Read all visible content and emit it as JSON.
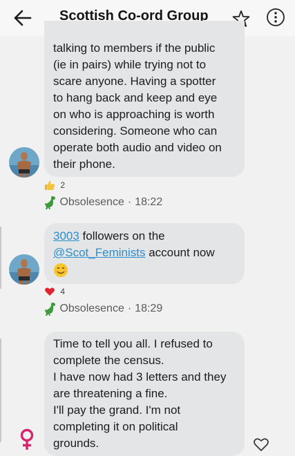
{
  "header": {
    "title": "Scottish Co-ord Group",
    "back_icon": "back-arrow-icon",
    "star_icon": "star-outline-icon",
    "more_icon": "more-vertical-icon"
  },
  "messages": [
    {
      "lines": [
        "talking to members if the public",
        "(ie in pairs) while trying not to",
        "scare anyone. Having a spotter",
        "to hang back and keep and eye",
        "on who is approaching is worth",
        "considering. Someone who can",
        "operate both audio and video on",
        "their phone."
      ],
      "reaction": {
        "icon": "thumbs-up-icon",
        "count": "2"
      },
      "sender": "Obsolesence",
      "separator": "·",
      "time": "18:22"
    },
    {
      "line1_link": "3003",
      "line1_text": " followers on the",
      "line2_link": "@Scot_Feminists",
      "line2_text": "  account now",
      "emoji": "smiling-face-icon",
      "reaction": {
        "icon": "heart-icon",
        "count": "4"
      },
      "sender": "Obsolesence",
      "separator": "·",
      "time": "18:29"
    },
    {
      "lines": [
        "Time to tell you all.  I refused to",
        "complete the census.",
        "I have now had 3 letters and they",
        "are threatening a fine.",
        "I'll pay the grand.  I'm not",
        "completing it on political",
        "grounds."
      ]
    }
  ],
  "colors": {
    "background": "#f1f1f1",
    "bubble": "#e4e5e6",
    "link": "#2a8ed0",
    "female_symbol": "#d6246f"
  }
}
